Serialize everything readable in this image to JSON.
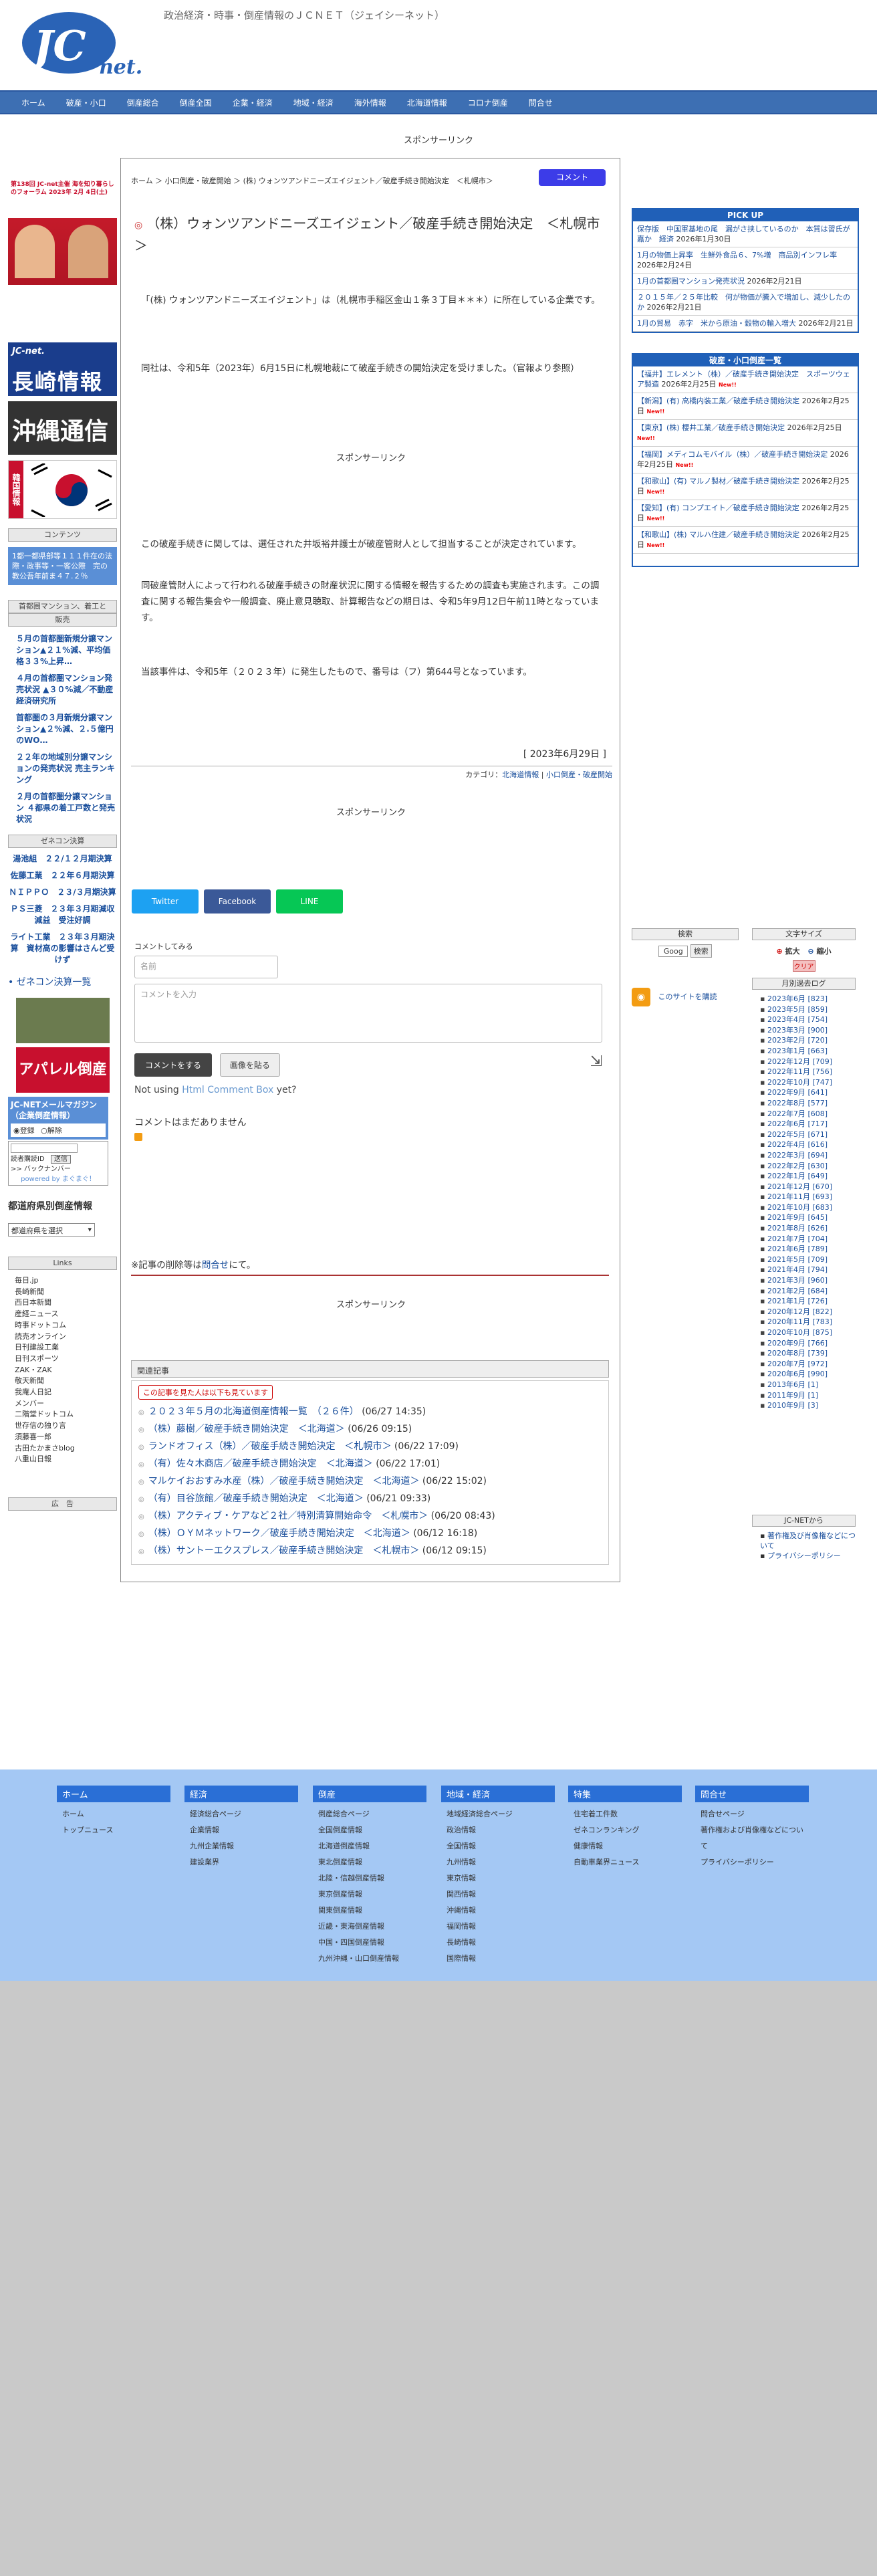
{
  "site": {
    "logo_text": "JC",
    "logo_sub": "net.",
    "tagline": "政治経済・時事・倒産情報のＪＣＮＥＴ（ジェイシーネット）"
  },
  "nav": [
    "ホーム",
    "破産・小口",
    "倒産総合",
    "倒産全国",
    "企業・経済",
    "地域・経済",
    "海外情報",
    "北海道情報",
    "コロナ倒産",
    "問合せ"
  ],
  "sponsor_label": "スポンサーリンク",
  "left": {
    "banners": [
      {
        "label": "第138回 JC-net主催\n海を知り暮らしのフォーラム\n2023年 2月 4日(土)",
        "color": "#c8102e"
      },
      {
        "label": "JC-net 長崎情報",
        "color": "#1a3d8c"
      },
      {
        "label": "沖縄通信",
        "color": "#222222"
      },
      {
        "label": "韓国情報",
        "color": "#ffffff"
      }
    ],
    "content_btn": "コンテンツ",
    "note": "1都一都県部等１１１件在の法際・政事等・一客公際　完の教公吾年前ま４７.２％",
    "note_title": "首都圏マンション、着工と",
    "sale_btn": "販売",
    "links": [
      "５月の首都圏新規分譲マンション▲２１%減、平均価格３３%上昇…",
      "４月の首都圏マンション発売状況 ▲３０%減／不動産経済研究所",
      "首都圏の３月新規分譲マンション▲２%減、２.５億円のWO…",
      "２２年の地域別分譲マンションの発売状況 売主ランキング",
      "２月の首都圏分譲マンション ４都県の着工戸数と発売状況"
    ],
    "zenecon_btn": "ゼネコン決算",
    "zenecon": [
      "湯池組　２２/１２月期決算",
      "佐藤工業　２２年６月期決算",
      "ＮＩＰＰＯ　２３/３月期決算",
      "ＰＳ三菱　２３年３月期減収減益　受注好調",
      "ライト工業　２３年３月期決算　資材高の影響はさんど受けず"
    ],
    "zenecon_list": "• ゼネコン決算一覧",
    "apparel_label": "アパレル倒産",
    "mag_title": "JC-NETメールマガジン（企業倒産情報）",
    "mag_options": [
      "登録",
      "解除"
    ],
    "mag_addr_label": "読者購読ID",
    "mag_send": "送信",
    "mag_backnumber": ">> バックナンバー",
    "mag_powered": "powered by まぐまぐ！",
    "pref_title": "都道府県別倒産情報",
    "pref_select": "都道府県を選択",
    "links_btn": "Links",
    "link_list": [
      "毎日.jp",
      "長崎新聞",
      "西日本新聞",
      "産経ニュース",
      "時事ドットコム",
      "読売オンライン",
      "日刊建設工業",
      "日刊スポーツ",
      "ZAK・ZAK",
      "敬天新聞",
      "我庵人日記",
      "メンバー",
      "二階堂ドットコム",
      "世存信の独り言",
      "須藤喜一郎",
      "古田たかまさblog",
      "八重山日報"
    ],
    "ad_btn": "広　告"
  },
  "main": {
    "breadcrumb": "ホーム ＞ 小口倒産・破産開始 ＞ (株) ウォンツアンドニーズエイジェント／破産手続き開始決定　＜札幌市＞",
    "comment_btn": "コメント",
    "title": "（株）ウォンツアンドニーズエイジェント／破産手続き開始決定　＜札幌市＞",
    "paragraphs": [
      "「(株) ウォンツアンドニーズエイジェント」は（札幌市手稲区金山１条３丁目＊＊＊）に所在している企業です。",
      "同社は、令和5年（2023年）6月15日に札幌地裁にて破産手続きの開始決定を受けました。（官報より参照）",
      "この破産手続きに関しては、選任された井坂裕井護士が破産管財人として担当することが決定されています。",
      "同破産管財人によって行われる破産手続きの財産状況に関する情報を報告するための調査も実施されます。この調査に関する報告集会や一般調査、廃止意見聴取、計算報告などの期日は、令和5年9月12日午前11時となっています。",
      "当該事件は、令和5年（２０２３年）に発生したもので、番号は（フ）第644号となっています。"
    ],
    "date": "[ 2023年6月29日 ]",
    "category_prefix": "カテゴリ：",
    "categories": [
      "北海道情報",
      "小口倒産・破産開始"
    ],
    "sns": [
      "Twitter",
      "Facebook",
      "LINE"
    ],
    "comment_try": "コメントしてみる",
    "name_placeholder": "名前",
    "comment_placeholder": "コメントを入力",
    "submit": "コメントをする",
    "image_btn": "画像を貼る",
    "not_using": "Not using ",
    "html_comment_box": "Html Comment Box",
    "yet": "  yet?",
    "no_comments": "コメントはまだありません",
    "delete_notice_pre": "※記事の削除等は",
    "delete_notice_link": "問合せ",
    "delete_notice_post": "にて。",
    "related_hdr": "関連記事",
    "related_tag": "この記事を見た人は以下も見ています",
    "related": [
      {
        "t": "２０２３年５月の北海道倒産情報一覧　（２６件）",
        "d": "(06/27 14:35)"
      },
      {
        "t": "（株）藤樹／破産手続き開始決定　＜北海道＞",
        "d": "(06/26 09:15)"
      },
      {
        "t": "ランドオフィス（株）／破産手続き開始決定　＜札幌市＞",
        "d": "(06/22 17:09)"
      },
      {
        "t": "（有）佐々木商店／破産手続き開始決定　＜北海道＞",
        "d": "(06/22 17:01)"
      },
      {
        "t": "マルケイおおすみ水産（株）／破産手続き開始決定　＜北海道＞",
        "d": "(06/22 15:02)"
      },
      {
        "t": "（有）目谷旅館／破産手続き開始決定　＜北海道＞",
        "d": "(06/21 09:33)"
      },
      {
        "t": "（株）アクティブ・ケアなど２社／特別清算開始命令　＜札幌市＞",
        "d": "(06/20 08:43)"
      },
      {
        "t": "（株）ＯＹＭネットワーク／破産手続き開始決定　＜北海道＞",
        "d": "(06/12 16:18)"
      },
      {
        "t": "（株）サントーエクスプレス／破産手続き開始決定　＜札幌市＞",
        "d": "(06/12 09:15)"
      }
    ]
  },
  "right": {
    "pickup_hdr": "PICK UP",
    "pickup": [
      {
        "t": "保存版　中国軍基地の尾　漏がさ挟しているのか　本質は習氏が嘉か　経済",
        "d": "2026年1月30日"
      },
      {
        "t": "1月の物価上昇率　生鮮外食品６、7%増　商品別インフレ率",
        "d": "2026年2月24日"
      },
      {
        "t": "1月の首都圏マンション発売状況",
        "d": "2026年2月21日"
      },
      {
        "t": "２０１５年／２５年比較　何が物価が騰入で増加し、減少したのか",
        "d": "2026年2月21日"
      },
      {
        "t": "1月の貿易　赤字　米から原油・穀物の輸入増大",
        "d": "2026年2月21日"
      }
    ],
    "list_hdr": "破産・小口倒産一覧",
    "list": [
      {
        "t": "【福井】エレメント（株）／破産手続き開始決定　スポーツウェア製造",
        "d": "2026年2月25日"
      },
      {
        "t": "【新潟】(有) 高橋内装工業／破産手続き開始決定",
        "d": "2026年2月25日"
      },
      {
        "t": "【東京】(株) 櫻井工業／破産手続き開始決定",
        "d": "2026年2月25日"
      },
      {
        "t": "【福岡】メディコムモバイル（株）／破産手続き開始決定",
        "d": "2026年2月25日"
      },
      {
        "t": "【和歌山】(有) マルノ製材／破産手続き開始決定",
        "d": "2026年2月25日"
      },
      {
        "t": "【愛知】(有) コンプエイト／破産手続き開始決定",
        "d": "2026年2月25日"
      },
      {
        "t": "【和歌山】(株) マルハ住建／破産手続き開始決定",
        "d": "2026年2月25日"
      }
    ],
    "new_label": "New!!",
    "search_title": "検索",
    "search_placeholder": "Goog",
    "search_btn": "検索",
    "font_title": "文字サイズ",
    "font_up": "拡大",
    "font_down": "縮小",
    "font_clear": "クリア",
    "rss_text": "このサイトを購読",
    "archive_title": "月別過去ログ",
    "archive": [
      "2023年6月 [823]",
      "2023年5月 [859]",
      "2023年4月 [754]",
      "2023年3月 [900]",
      "2023年2月 [720]",
      "2023年1月 [663]",
      "2022年12月 [709]",
      "2022年11月 [756]",
      "2022年10月 [747]",
      "2022年9月 [641]",
      "2022年8月 [577]",
      "2022年7月 [608]",
      "2022年6月 [717]",
      "2022年5月 [671]",
      "2022年4月 [616]",
      "2022年3月 [694]",
      "2022年2月 [630]",
      "2022年1月 [649]",
      "2021年12月 [670]",
      "2021年11月 [693]",
      "2021年10月 [683]",
      "2021年9月 [645]",
      "2021年8月 [626]",
      "2021年7月 [704]",
      "2021年6月 [789]",
      "2021年5月 [709]",
      "2021年4月 [794]",
      "2021年3月 [960]",
      "2021年2月 [684]",
      "2021年1月 [726]",
      "2020年12月 [822]",
      "2020年11月 [783]",
      "2020年10月 [875]",
      "2020年9月 [766]",
      "2020年8月 [739]",
      "2020年7月 [972]",
      "2020年6月 [990]",
      "2013年6月 [1]",
      "2011年9月 [1]",
      "2010年9月 [3]"
    ],
    "jcnet_title": "JC-NETから",
    "jcnet": [
      "著作権及び肖像権などについて",
      "プライバシーポリシー"
    ]
  },
  "footer": [
    {
      "hdr": "ホーム",
      "items": [
        "ホーム",
        "トップニュース"
      ]
    },
    {
      "hdr": "経済",
      "items": [
        "経済総合ページ",
        "企業情報",
        "九州企業情報",
        "建設業界"
      ]
    },
    {
      "hdr": "倒産",
      "items": [
        "倒産総合ページ",
        "全国倒産情報",
        "北海道倒産情報",
        "東北倒産情報",
        "北陸・信越倒産情報",
        "東京倒産情報",
        "関東倒産情報",
        "近畿・東海倒産情報",
        "中国・四国倒産情報",
        "九州沖縄・山口倒産情報"
      ]
    },
    {
      "hdr": "地域・経済",
      "items": [
        "地域経済総合ページ",
        "政治情報",
        "全国情報",
        "九州情報",
        "東京情報",
        "関西情報",
        "沖縄情報",
        "福岡情報",
        "長崎情報",
        "国際情報"
      ]
    },
    {
      "hdr": "特集",
      "items": [
        "住宅着工件数",
        "ゼネコンランキング",
        "健康情報",
        "自動車業界ニュース"
      ]
    },
    {
      "hdr": "問合せ",
      "items": [
        "問合せページ",
        "著作権および肖像権などについて",
        "プライバシーポリシー"
      ]
    }
  ]
}
